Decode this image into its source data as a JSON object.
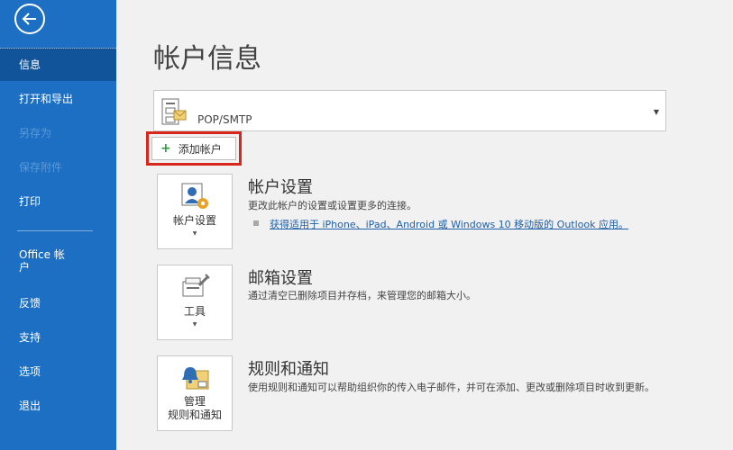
{
  "sidebar": {
    "items": [
      {
        "label": "信息"
      },
      {
        "label": "打开和导出"
      },
      {
        "label": "另存为"
      },
      {
        "label": "保存附件"
      },
      {
        "label": "打印"
      },
      {
        "label": "Office 帐户"
      },
      {
        "label": "反馈"
      },
      {
        "label": "支持"
      },
      {
        "label": "选项"
      },
      {
        "label": "退出"
      }
    ]
  },
  "main": {
    "title": "帐户信息",
    "account": {
      "type": "POP/SMTP"
    },
    "add_account_label": "添加帐户",
    "sections": [
      {
        "tile_label": "帐户设置",
        "title": "帐户设置",
        "description": "更改此帐户的设置或设置更多的连接。",
        "link": "获得适用于 iPhone、iPad、Android 或 Windows 10 移动版的 Outlook 应用。"
      },
      {
        "tile_label": "工具",
        "title": "邮箱设置",
        "description": "通过清空已删除项目并存档，来管理您的邮箱大小。"
      },
      {
        "tile_label_1": "管理",
        "tile_label_2": "规则和通知",
        "title": "规则和通知",
        "description": "使用规则和通知可以帮助组织你的传入电子邮件，并可在添加、更改或删除项目时收到更新。"
      }
    ]
  },
  "colors": {
    "sidebar": "#1c6fc3",
    "sidebar_active": "#12549a",
    "highlight": "#d9261c",
    "link": "#1f5fa8"
  }
}
